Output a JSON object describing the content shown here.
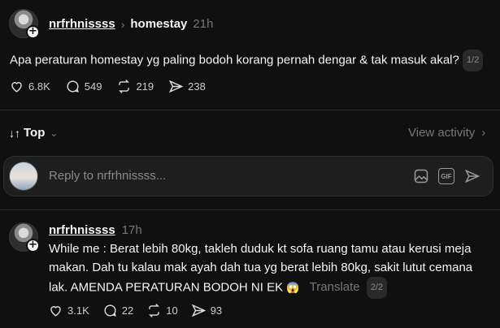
{
  "post": {
    "username": "nrfrhnissss",
    "topic": "homestay",
    "time": "21h",
    "text": "Apa peraturan homestay yg paling bodoh korang pernah dengar & tak masuk akal?",
    "thread_index": "1/2",
    "actions": {
      "likes": "6.8K",
      "comments": "549",
      "reposts": "219",
      "shares": "238"
    }
  },
  "sort": {
    "label": "Top",
    "view_activity": "View activity"
  },
  "composer": {
    "placeholder": "Reply to nrfrhnissss...",
    "gif_label": "GIF"
  },
  "reply": {
    "username": "nrfrhnissss",
    "time": "17h",
    "line1": "While me : Berat lebih 80kg, takleh duduk kt sofa ruang tamu atau kerusi meja",
    "line2": "makan. Dah tu kalau mak ayah dah tua yg berat lebih 80kg, sakit lutut cemana",
    "line3": "lak. AMENDA PERATURAN BODOH NI EK",
    "emoji": "😱",
    "translate": "Translate",
    "thread_index": "2/2",
    "actions": {
      "likes": "3.1K",
      "comments": "22",
      "reposts": "10",
      "shares": "93"
    }
  },
  "colors": {
    "background": "#101010",
    "text": "#f3f5f7",
    "muted": "#777777",
    "surface": "#1e1e1e"
  }
}
